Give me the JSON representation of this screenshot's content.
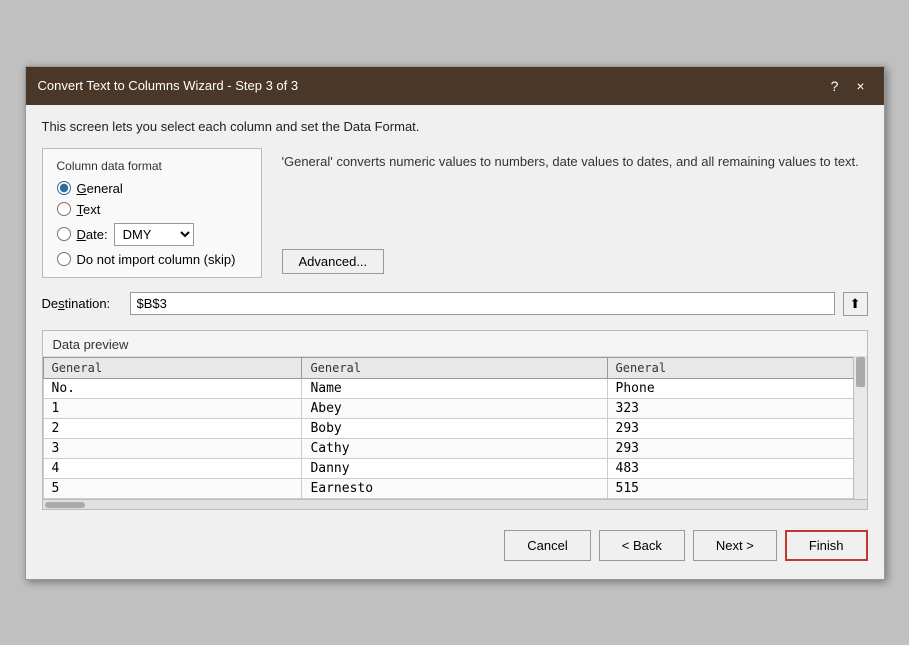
{
  "dialog": {
    "title": "Convert Text to Columns Wizard - Step 3 of 3",
    "help_button": "?",
    "close_button": "×"
  },
  "description": "This screen lets you select each column and set the Data Format.",
  "column_format": {
    "label": "Column data format",
    "options": [
      {
        "id": "general",
        "label": "General",
        "checked": true,
        "underline_index": 0
      },
      {
        "id": "text",
        "label": "Text",
        "checked": false,
        "underline_index": 0
      },
      {
        "id": "date",
        "label": "Date:",
        "checked": false,
        "underline_index": 0
      },
      {
        "id": "skip",
        "label": "Do not import column (skip)",
        "checked": false
      }
    ],
    "date_format": "DMY"
  },
  "right_panel": {
    "description": "'General' converts numeric values to numbers, date values to dates, and all remaining values to text.",
    "advanced_button": "Advanced..."
  },
  "destination": {
    "label": "Destination:",
    "value": "$B$3",
    "underline_char": "s"
  },
  "data_preview": {
    "label": "Data preview",
    "columns": [
      "General",
      "General",
      "General"
    ],
    "rows": [
      [
        "No.",
        "Name",
        "Phone"
      ],
      [
        "1",
        "Abey",
        "323"
      ],
      [
        "2",
        "Boby",
        "293"
      ],
      [
        "3",
        "Cathy",
        "293"
      ],
      [
        "4",
        "Danny",
        "483"
      ],
      [
        "5",
        "Earnesto",
        "515"
      ]
    ]
  },
  "footer": {
    "cancel_label": "Cancel",
    "back_label": "< Back",
    "next_label": "Next >",
    "finish_label": "Finish"
  }
}
